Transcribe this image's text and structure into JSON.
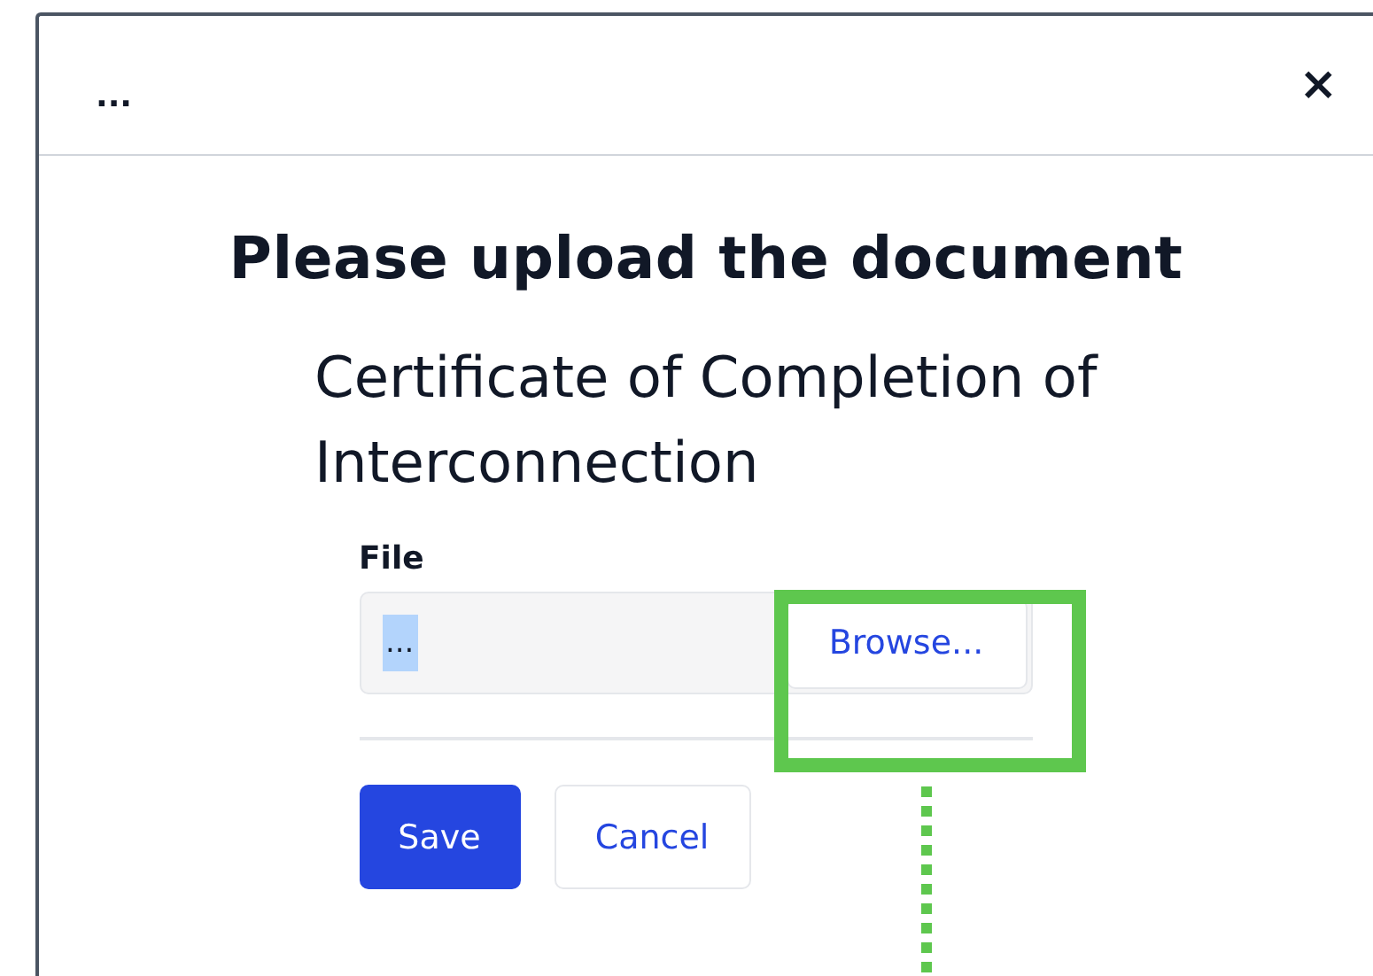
{
  "dialog": {
    "title": "...",
    "close": "×"
  },
  "heading": "Please upload the document",
  "document_name": "Certificate of Completion of Interconnection",
  "file_field": {
    "label": "File",
    "value": "...",
    "text_selected": true,
    "browse_button": "Browse..."
  },
  "buttons": [
    {
      "label": "Save",
      "kind": "primary"
    },
    {
      "label": "Cancel",
      "kind": "secondary"
    }
  ]
}
